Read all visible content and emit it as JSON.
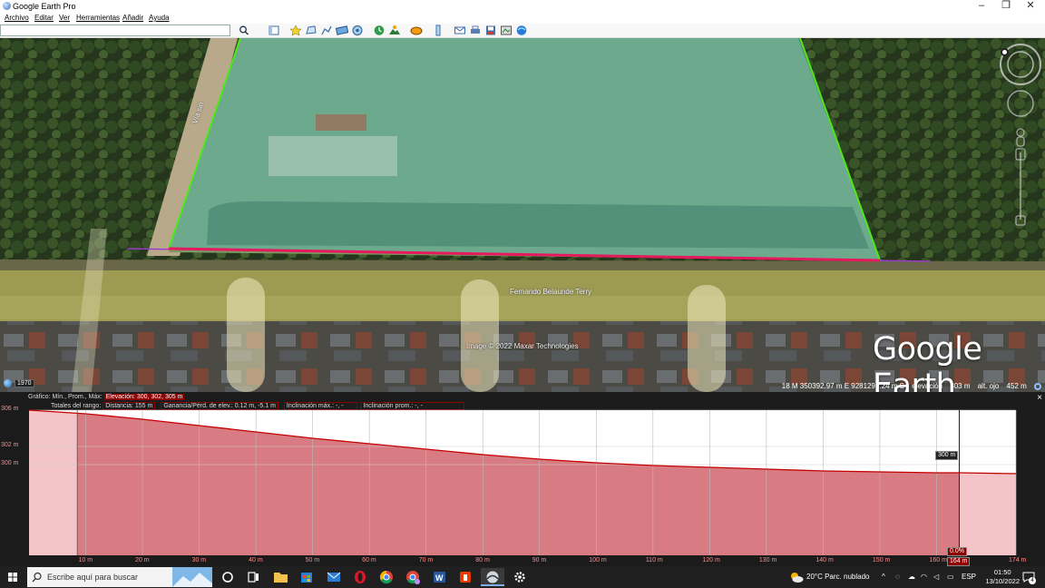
{
  "window": {
    "title": "Google Earth Pro",
    "minimize_glyph": "–",
    "restore_glyph": "❐",
    "close_glyph": "✕"
  },
  "menubar": {
    "items": [
      "Archivo",
      "Editar",
      "Ver",
      "Herramientas",
      "Añadir",
      "Ayuda"
    ]
  },
  "search": {
    "value": "",
    "placeholder": ""
  },
  "toolbar": {
    "icons": [
      "search-icon",
      "sidebar-toggle-icon",
      "placemark-icon",
      "polygon-icon",
      "path-icon",
      "image-overlay-icon",
      "tour-icon",
      "historical-imagery-icon",
      "sunlight-icon",
      "planets-icon",
      "ruler-icon",
      "email-icon",
      "print-icon",
      "save-image-icon",
      "map-view-icon",
      "google-maps-icon"
    ]
  },
  "map": {
    "road_label_vertical": "Vía sin",
    "road_label_main": "Fernando Belaunde Terry",
    "imagery_credit": "Image © 2022 Maxar Technologies",
    "logo": "Google Earth",
    "imagery_year": "1970",
    "status": {
      "coords": "18 M 350392.97 m E 9281299.24 m S",
      "elevation_label": "elevación",
      "elevation_value": "303 m",
      "eye_alt_label": "alt. ojo",
      "eye_alt_value": "452 m"
    },
    "colors": {
      "polygon_fill": "#5fb7b0",
      "polygon_side": "#4fe81a",
      "profile_path": "#e5195d",
      "extension_line": "#9a3cc8"
    }
  },
  "profile": {
    "row1": {
      "label": "Gráfico: Mín., Prom., Máx:",
      "value": "Elevación: 300, 302, 305 m"
    },
    "row2": {
      "label": "Totales del rango:",
      "distance": "Distancia: 155 m",
      "gain_loss": "Ganancia/Pérd. de elev.: 0.12 m, -5.1 m",
      "max_slope": "Inclinación máx.: -, -",
      "avg_slope": "Inclinación prom.: -, -"
    },
    "close_glyph": "×",
    "cursor_elevation_tag": "300 m",
    "cursor_distance_tag": "164 m",
    "cursor_slope_tag": "0.0%",
    "colors": {
      "area_fill": "#d97b82",
      "line": "#c40000"
    }
  },
  "chart_data": {
    "type": "area",
    "title": "",
    "xlabel": "",
    "ylabel": "",
    "x_ticks": [
      "10 m",
      "20 m",
      "30 m",
      "40 m",
      "50 m",
      "60 m",
      "70 m",
      "80 m",
      "90 m",
      "100 m",
      "110 m",
      "120 m",
      "130 m",
      "140 m",
      "150 m",
      "160 m",
      "174 m"
    ],
    "y_ticks": [
      "306 m",
      "302 m",
      "300 m"
    ],
    "xlim": [
      0,
      174
    ],
    "ylim": [
      290,
      306
    ],
    "series": [
      {
        "x": [
          0,
          10,
          20,
          30,
          40,
          50,
          60,
          70,
          80,
          90,
          100,
          110,
          120,
          130,
          140,
          150,
          160,
          164,
          174
        ],
        "y": [
          306,
          305.6,
          305,
          304.3,
          303.6,
          302.9,
          302.3,
          301.7,
          301.1,
          300.6,
          300.2,
          299.9,
          299.7,
          299.5,
          299.3,
          299.2,
          299.1,
          299.1,
          299.0
        ]
      }
    ],
    "selected_range": [
      8.5,
      164
    ],
    "grid": true
  },
  "taskbar": {
    "search_placeholder": "Escribe aquí para buscar",
    "weather": "20°C  Parc. nublado",
    "language": "ESP",
    "time": "01:50",
    "date": "13/10/2022",
    "notification_count": "4"
  }
}
